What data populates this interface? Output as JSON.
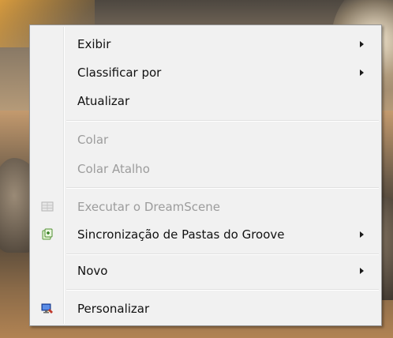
{
  "menu": {
    "items": [
      {
        "label": "Exibir",
        "enabled": true,
        "submenu": true
      },
      {
        "label": "Classificar por",
        "enabled": true,
        "submenu": true
      },
      {
        "label": "Atualizar",
        "enabled": true,
        "submenu": false
      },
      {
        "label": "Colar",
        "enabled": false,
        "submenu": false
      },
      {
        "label": "Colar Atalho",
        "enabled": false,
        "submenu": false
      },
      {
        "label": "Executar o DreamScene",
        "enabled": false,
        "submenu": false,
        "icon": "dreamscene-icon"
      },
      {
        "label": "Sincronização de Pastas do Groove",
        "enabled": true,
        "submenu": true,
        "icon": "groove-sync-icon"
      },
      {
        "label": "Novo",
        "enabled": true,
        "submenu": true
      },
      {
        "label": "Personalizar",
        "enabled": true,
        "submenu": false,
        "icon": "personalize-icon"
      }
    ]
  },
  "colors": {
    "menu_background": "#f1f1f1",
    "menu_border": "#979797",
    "text": "#111111",
    "disabled_text": "#9c9c9c"
  }
}
